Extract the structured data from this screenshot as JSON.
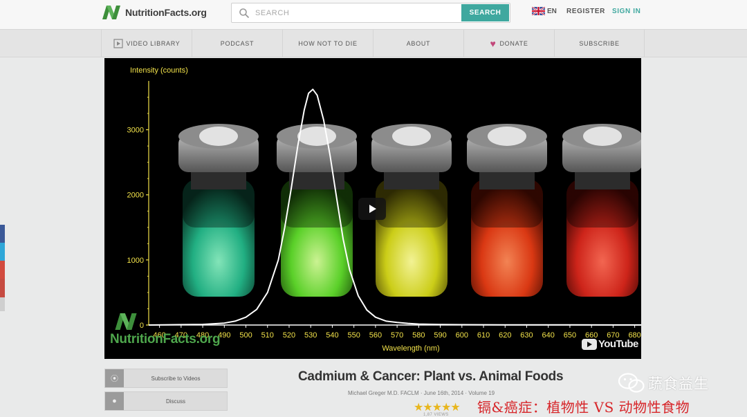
{
  "header": {
    "logo_text": "NutritionFacts.org",
    "search_placeholder": "SEARCH",
    "search_button": "SEARCH",
    "language": "EN",
    "register": "REGISTER",
    "sign_in": "SIGN IN"
  },
  "nav": {
    "items": [
      {
        "label": "VIDEO LIBRARY",
        "icon": "video-library-icon"
      },
      {
        "label": "PODCAST"
      },
      {
        "label": "HOW NOT TO DIE"
      },
      {
        "label": "ABOUT"
      },
      {
        "label": "DONATE",
        "icon": "heart-icon"
      },
      {
        "label": "SUBSCRIBE"
      }
    ]
  },
  "video": {
    "watermark": "NutritionFacts.org",
    "platform": "YouTube"
  },
  "chart_data": {
    "type": "line",
    "ylabel": "Intensity (counts)",
    "xlabel": "Wavelength (nm)",
    "x_ticks": [
      460,
      470,
      480,
      490,
      500,
      510,
      520,
      530,
      540,
      550,
      560,
      570,
      580,
      590,
      600,
      610,
      620,
      630,
      640,
      650,
      660,
      670,
      680
    ],
    "y_ticks": [
      0,
      1000,
      2000,
      3000
    ],
    "xlim": [
      455,
      683
    ],
    "ylim": [
      0,
      3750
    ],
    "series": [
      {
        "color": "#ffffff",
        "x": [
          455,
          480,
          490,
          495,
          500,
          505,
          510,
          515,
          518,
          521,
          524,
          527,
          529,
          531,
          533,
          536,
          539,
          542,
          545,
          548,
          552,
          556,
          560,
          565,
          570,
          575,
          580,
          590,
          600,
          620,
          650,
          683
        ],
        "y": [
          0,
          10,
          30,
          60,
          120,
          240,
          500,
          1000,
          1500,
          2100,
          2750,
          3300,
          3560,
          3620,
          3530,
          3150,
          2600,
          1950,
          1320,
          850,
          450,
          230,
          120,
          60,
          40,
          25,
          15,
          8,
          5,
          3,
          2,
          1
        ]
      }
    ]
  },
  "video_actions": {
    "subscribe": "Subscribe to Videos",
    "discuss": "Discuss"
  },
  "video_info": {
    "title": "Cadmium & Cancer: Plant vs. Animal Foods",
    "meta": "Michael Greger M.D. FACLM · June 16th, 2014 · Volume 19",
    "rating": 4.5,
    "views": "1,87 VIEWS"
  },
  "overlay": {
    "account": "蔬食益生",
    "caption": "镉&癌症：植物性 VS 动物性食物"
  },
  "colors": {
    "accent": "#3fa89f",
    "brand_green": "#4ea64c",
    "donate_heart": "#c2477a",
    "star": "#e8b61d",
    "caption_red": "#d7262a",
    "axis_tick": "#f2e24a"
  }
}
